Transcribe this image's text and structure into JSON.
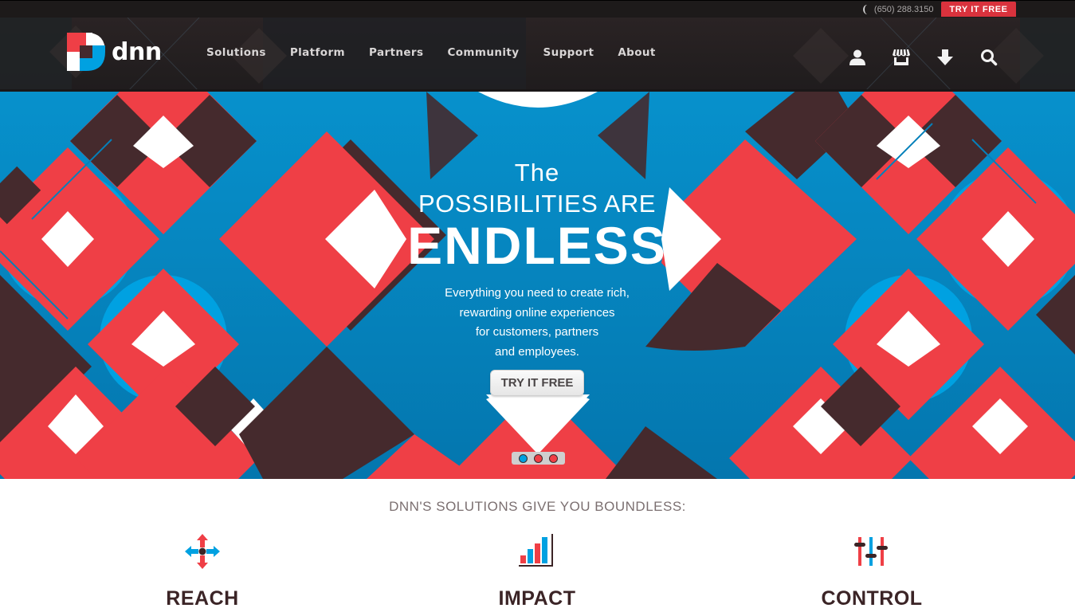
{
  "topbar": {
    "phone_icon": "phone-icon",
    "phone": "(650) 288.3150",
    "try_free": "TRY IT FREE"
  },
  "navbar": {
    "logo_text": "DNN",
    "links": [
      {
        "label": "Solutions"
      },
      {
        "label": "Platform"
      },
      {
        "label": "Partners"
      },
      {
        "label": "Community"
      },
      {
        "label": "Support"
      },
      {
        "label": "About"
      }
    ],
    "icons": [
      "user-icon",
      "store-icon",
      "download-icon",
      "search-icon"
    ]
  },
  "hero": {
    "line1": "The",
    "line2": "POSSIBILITIES ARE",
    "line3": "ENDLESS",
    "subtitle_lines": [
      "Everything you need to create rich,",
      "rewarding online experiences",
      "for customers, partners",
      "and employees."
    ],
    "cta": "TRY IT FREE",
    "slides": {
      "count": 3,
      "active": 1
    }
  },
  "solutions": {
    "heading": "DNN'S SOLUTIONS GIVE YOU BOUNDLESS:",
    "features": [
      {
        "title": "REACH",
        "icon": "arrows-out-icon"
      },
      {
        "title": "IMPACT",
        "icon": "bar-chart-icon"
      },
      {
        "title": "CONTROL",
        "icon": "sliders-icon"
      }
    ]
  },
  "colors": {
    "red": "#ef3f46",
    "blue": "#00a1e1",
    "blue_dark": "#0580ba",
    "brown": "#452a2d",
    "white": "#ffffff",
    "nav_bg": "#231f20",
    "cta_red": "#d9323d"
  }
}
